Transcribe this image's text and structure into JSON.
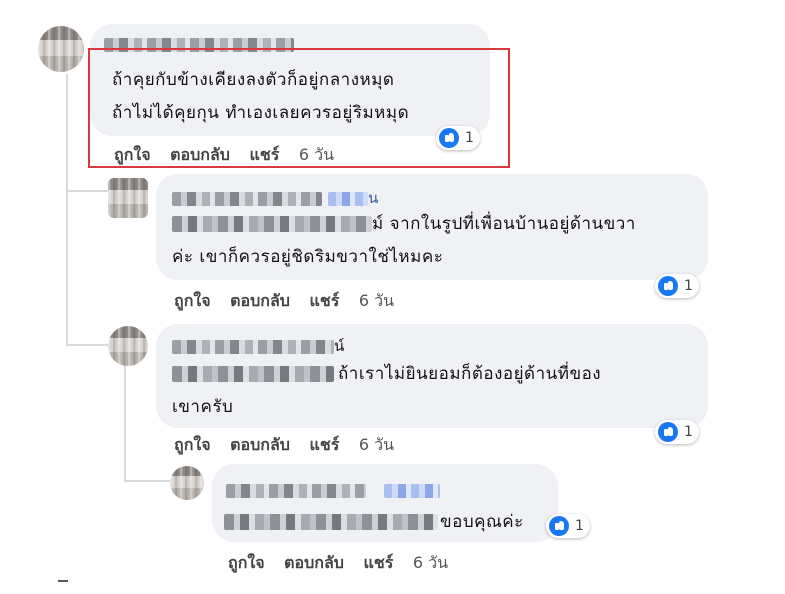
{
  "reaction_icon": "like-icon",
  "accent_color": "#1877f2",
  "highlight_color": "#d9393e",
  "comments": [
    {
      "lines": [
        "ถ้าคุยกับข้างเคียงลงตัวก็อยู่กลางหมุด",
        "ถ้าไม่ได้คุยกุน ทำเองเลยควรอยู่ริมหมุด"
      ],
      "like": "ถูกใจ",
      "reply": "ตอบกลับ",
      "share": "แชร์",
      "time": "6 วัน",
      "reaction_count": "1"
    },
    {
      "name_suffix": "น",
      "lines": [
        "ม์ จากในรูปที่เพื่อนบ้านอยู่ด้านขวา",
        "ค่ะ เขาก็ควรอยู่ชิดริมขวาใช่ไหมคะ"
      ],
      "like": "ถูกใจ",
      "reply": "ตอบกลับ",
      "share": "แชร์",
      "time": "6 วัน",
      "reaction_count": "1"
    },
    {
      "name_suffix": "น์",
      "lines": [
        "ถ้าเราไม่ยินยอมก็ต้องอยู่ด้านที่ของ",
        "เขาครับ"
      ],
      "like": "ถูกใจ",
      "reply": "ตอบกลับ",
      "share": "แชร์",
      "time": "6 วัน",
      "reaction_count": "1"
    },
    {
      "lines": [
        "ขอบคุณค่ะ"
      ],
      "like": "ถูกใจ",
      "reply": "ตอบกลับ",
      "share": "แชร์",
      "time": "6 วัน",
      "reaction_count": "1"
    }
  ]
}
